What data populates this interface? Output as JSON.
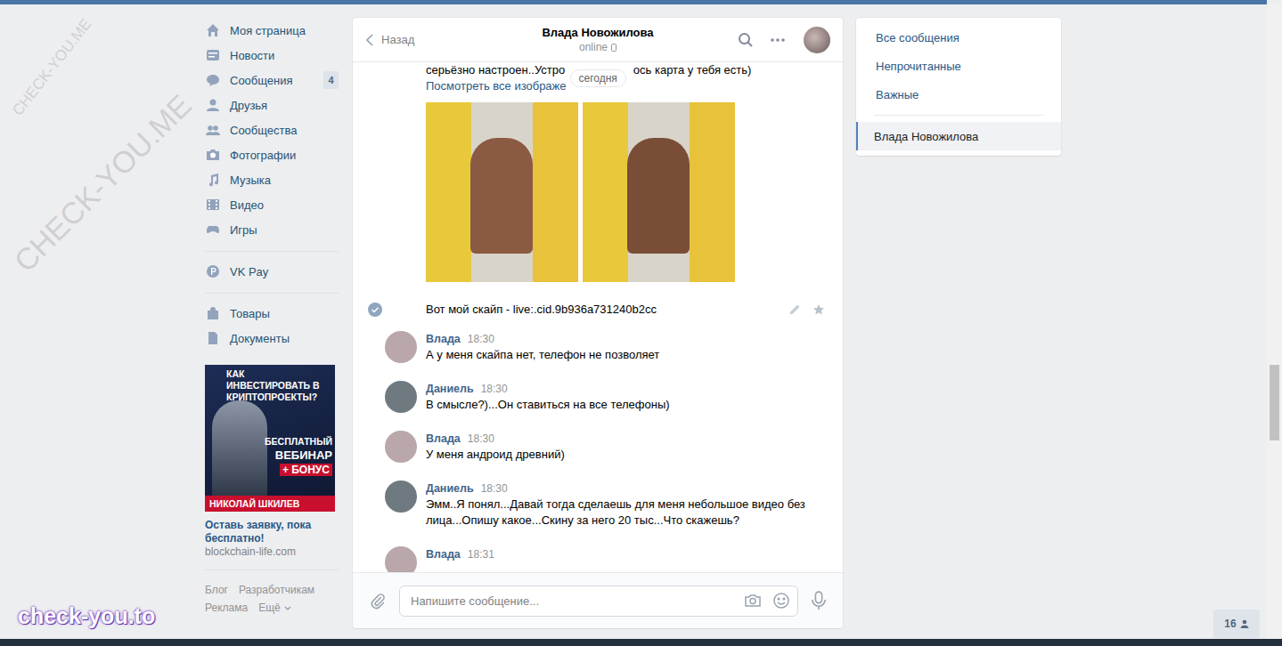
{
  "watermarks": [
    "CHECK-YOU.ME",
    "CHECK-YOU.ME"
  ],
  "site_mark": "check-you.to",
  "nav": {
    "groups": [
      [
        {
          "label": "Моя страница",
          "badge": ""
        },
        {
          "label": "Новости",
          "badge": ""
        },
        {
          "label": "Сообщения",
          "badge": "4"
        },
        {
          "label": "Друзья",
          "badge": ""
        },
        {
          "label": "Сообщества",
          "badge": ""
        },
        {
          "label": "Фотографии",
          "badge": ""
        },
        {
          "label": "Музыка",
          "badge": ""
        },
        {
          "label": "Видео",
          "badge": ""
        },
        {
          "label": "Игры",
          "badge": ""
        }
      ],
      [
        {
          "label": "VK Pay",
          "badge": ""
        }
      ],
      [
        {
          "label": "Товары",
          "badge": ""
        },
        {
          "label": "Документы",
          "badge": ""
        }
      ]
    ]
  },
  "ad": {
    "banner": {
      "headline": "КАК ИНВЕСТИРОВАТЬ В КРИПТОПРОЕКТЫ?",
      "line1": "БЕСПЛАТНЫЙ",
      "line2": "ВЕБИНАР",
      "bonus": "+ БОНУС",
      "name": "НИКОЛАЙ ШКИЛЕВ"
    },
    "title": "Оставь заявку, пока бесплатно!",
    "domain": "blockchain-life.com"
  },
  "footer": [
    "Блог",
    "Разработчикам",
    "Реклама",
    "Ещё"
  ],
  "chat": {
    "back": "Назад",
    "title": "Влада Новожилова",
    "status": "online",
    "date_pill": "сегодня",
    "messages": [
      {
        "kind": "cont",
        "parts": [
          "серьёзно настроен..Устро",
          "ось карта у тебя есть)"
        ],
        "link": "Посмотреть все изображе"
      },
      {
        "kind": "photos",
        "count": 2
      },
      {
        "kind": "own",
        "text": "Вот мой скайп - live:.cid.9b936a731240b2cc",
        "checked": true
      },
      {
        "kind": "message",
        "author": "Влада",
        "time": "18:30",
        "text": "А у меня скайпа нет, телефон не позволяет",
        "avatar_color": "#b9a7a9"
      },
      {
        "kind": "message",
        "author": "Даниель",
        "time": "18:30",
        "text": "В смысле?)...Он ставиться на все телефоны)",
        "avatar_color": "#6f7a80"
      },
      {
        "kind": "message",
        "author": "Влада",
        "time": "18:30",
        "text": "У меня андроид древний)",
        "avatar_color": "#b9a7a9"
      },
      {
        "kind": "message",
        "author": "Даниель",
        "time": "18:30",
        "text": "Эмм..Я понял...Давай тогда сделаешь для меня небольшое видео без лица...Опишу какое...Скину за него 20 тыс...Что скажешь?",
        "avatar_color": "#6f7a80"
      },
      {
        "kind": "message",
        "author": "Влада",
        "time": "18:31",
        "text": "",
        "avatar_color": "#b9a7a9"
      }
    ],
    "input_placeholder": "Напишите сообщение..."
  },
  "right_panel": {
    "items": [
      {
        "label": "Все сообщения",
        "selected": false
      },
      {
        "label": "Непрочитанные",
        "selected": false
      },
      {
        "label": "Важные",
        "selected": false
      },
      {
        "label": "Влада Новожилова",
        "selected": true
      }
    ]
  },
  "online_badge": "16"
}
